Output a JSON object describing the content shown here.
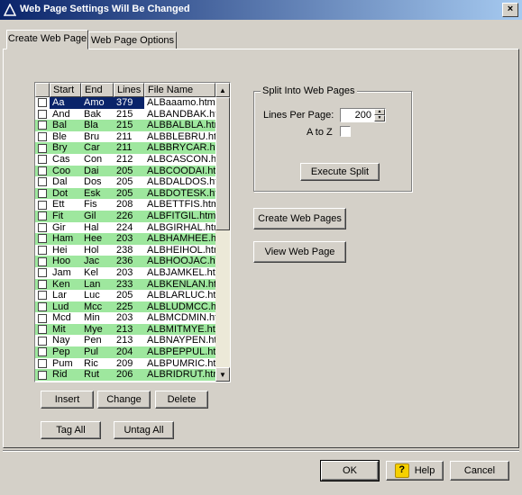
{
  "window": {
    "title": "Web Page Settings Will Be Changed",
    "close_label": "×",
    "icon": "app-triangle-icon"
  },
  "tabs": [
    {
      "label": "Create Web Page",
      "active": true
    },
    {
      "label": "Web Page Options",
      "active": false
    }
  ],
  "list": {
    "columns": [
      "",
      "Start",
      "End",
      "Lines",
      "File Name"
    ],
    "rows": [
      {
        "start": "Aa",
        "end": "Amo",
        "lines": "379",
        "file": "ALBaaamo.html",
        "checked": false,
        "green": false,
        "selected": true
      },
      {
        "start": "And",
        "end": "Bak",
        "lines": "215",
        "file": "ALBANDBAK.ht",
        "checked": false,
        "green": false,
        "selected": false
      },
      {
        "start": "Bal",
        "end": "Bla",
        "lines": "215",
        "file": "ALBBALBLA.htr",
        "checked": false,
        "green": true,
        "selected": false
      },
      {
        "start": "Ble",
        "end": "Bru",
        "lines": "211",
        "file": "ALBBLEBRU.htr",
        "checked": false,
        "green": false,
        "selected": false
      },
      {
        "start": "Bry",
        "end": "Car",
        "lines": "211",
        "file": "ALBBRYCAR.ht",
        "checked": false,
        "green": true,
        "selected": false
      },
      {
        "start": "Cas",
        "end": "Con",
        "lines": "212",
        "file": "ALBCASCON.ht",
        "checked": false,
        "green": false,
        "selected": false
      },
      {
        "start": "Coo",
        "end": "Dai",
        "lines": "205",
        "file": "ALBCOODAI.htr",
        "checked": false,
        "green": true,
        "selected": false
      },
      {
        "start": "Dal",
        "end": "Dos",
        "lines": "205",
        "file": "ALBDALDOS.ht",
        "checked": false,
        "green": false,
        "selected": false
      },
      {
        "start": "Dot",
        "end": "Esk",
        "lines": "205",
        "file": "ALBDOTESK.htr",
        "checked": false,
        "green": true,
        "selected": false
      },
      {
        "start": "Ett",
        "end": "Fis",
        "lines": "208",
        "file": "ALBETTFIS.htm",
        "checked": false,
        "green": false,
        "selected": false
      },
      {
        "start": "Fit",
        "end": "Gil",
        "lines": "226",
        "file": "ALBFITGIL.html",
        "checked": false,
        "green": true,
        "selected": false
      },
      {
        "start": "Gir",
        "end": "Hal",
        "lines": "224",
        "file": "ALBGIRHAL.htm",
        "checked": false,
        "green": false,
        "selected": false
      },
      {
        "start": "Ham",
        "end": "Hee",
        "lines": "203",
        "file": "ALBHAMHEE.ht",
        "checked": false,
        "green": true,
        "selected": false
      },
      {
        "start": "Hei",
        "end": "Hol",
        "lines": "238",
        "file": "ALBHEIHOL.htn",
        "checked": false,
        "green": false,
        "selected": false
      },
      {
        "start": "Hoo",
        "end": "Jac",
        "lines": "236",
        "file": "ALBHOOJAC.ht",
        "checked": false,
        "green": true,
        "selected": false
      },
      {
        "start": "Jam",
        "end": "Kel",
        "lines": "203",
        "file": "ALBJAMKEL.htr",
        "checked": false,
        "green": false,
        "selected": false
      },
      {
        "start": "Ken",
        "end": "Lan",
        "lines": "233",
        "file": "ALBKENLAN.ht",
        "checked": false,
        "green": true,
        "selected": false
      },
      {
        "start": "Lar",
        "end": "Luc",
        "lines": "205",
        "file": "ALBLARLUC.htr",
        "checked": false,
        "green": false,
        "selected": false
      },
      {
        "start": "Lud",
        "end": "Mcc",
        "lines": "225",
        "file": "ALBLUDMCC.ht",
        "checked": false,
        "green": true,
        "selected": false
      },
      {
        "start": "Mcd",
        "end": "Min",
        "lines": "203",
        "file": "ALBMCDMIN.ht",
        "checked": false,
        "green": false,
        "selected": false
      },
      {
        "start": "Mit",
        "end": "Mye",
        "lines": "213",
        "file": "ALBMITMYE.ht",
        "checked": false,
        "green": true,
        "selected": false
      },
      {
        "start": "Nay",
        "end": "Pen",
        "lines": "213",
        "file": "ALBNAYPEN.ht",
        "checked": false,
        "green": false,
        "selected": false
      },
      {
        "start": "Pep",
        "end": "Pul",
        "lines": "204",
        "file": "ALBPEPPUL.htr",
        "checked": false,
        "green": true,
        "selected": false
      },
      {
        "start": "Pum",
        "end": "Ric",
        "lines": "209",
        "file": "ALBPUMRIC.htr",
        "checked": false,
        "green": false,
        "selected": false
      },
      {
        "start": "Rid",
        "end": "Rut",
        "lines": "206",
        "file": "ALBRIDRUT.htn",
        "checked": false,
        "green": true,
        "selected": false
      }
    ]
  },
  "list_buttons": {
    "insert": "Insert",
    "change": "Change",
    "delete": "Delete",
    "tag_all": "Tag All",
    "untag_all": "Untag All"
  },
  "split": {
    "group_title": "Split Into Web Pages",
    "lines_label": "Lines Per Page:",
    "lines_value": "200",
    "atoz_label": "A to Z",
    "atoz_checked": false,
    "execute": "Execute Split"
  },
  "actions": {
    "create": "Create Web Pages",
    "view": "View Web Page"
  },
  "footer": {
    "ok": "OK",
    "help": "Help",
    "cancel": "Cancel"
  },
  "colors": {
    "green_row": "#9ee79e",
    "selection": "#0a246a",
    "title_start": "#0a246a"
  }
}
